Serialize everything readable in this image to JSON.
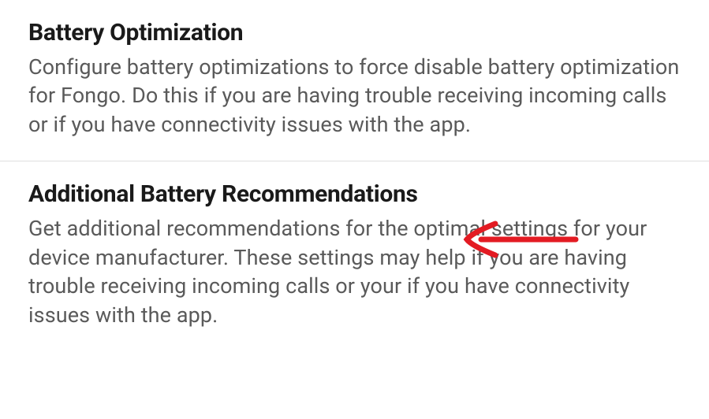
{
  "settings": [
    {
      "title": "Battery Optimization",
      "description": "Configure battery optimizations to force disable battery optimization for Fongo. Do this if you are having trouble receiving incoming calls or if you have connectivity issues with the app."
    },
    {
      "title": "Additional Battery Recommendations",
      "description": "Get additional recommendations for the optimal settings for your device manufacturer. These settings may help if you are having trouble receiving incoming calls or your if you have connectivity issues with the app."
    }
  ],
  "annotation": {
    "color": "#e31b23"
  }
}
